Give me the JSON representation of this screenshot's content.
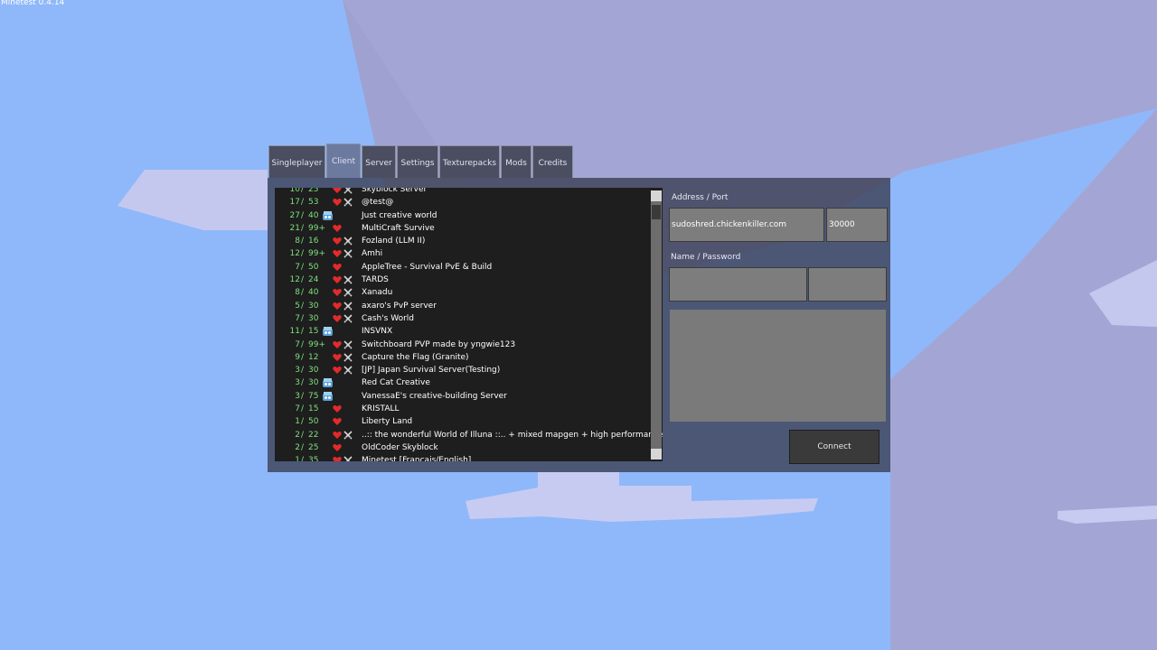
{
  "version": "Minetest 0.4.14",
  "tabs": [
    {
      "label": "Singleplayer",
      "active": false
    },
    {
      "label": "Client",
      "active": true
    },
    {
      "label": "Server",
      "active": false
    },
    {
      "label": "Settings",
      "active": false
    },
    {
      "label": "Texturepacks",
      "active": false
    },
    {
      "label": "Mods",
      "active": false
    },
    {
      "label": "Credits",
      "active": false
    }
  ],
  "server_list": [
    {
      "clients": "10",
      "max": "25",
      "flags": [
        "damage",
        "pvp"
      ],
      "name": "Skyblock Server"
    },
    {
      "clients": "17",
      "max": "53",
      "flags": [
        "damage",
        "pvp"
      ],
      "name": "@test@"
    },
    {
      "clients": "27",
      "max": "40",
      "flags": [
        "creative"
      ],
      "name": "Just creative world"
    },
    {
      "clients": "21",
      "max": "99+",
      "flags": [
        "damage"
      ],
      "name": "MultiCraft Survive"
    },
    {
      "clients": "8",
      "max": "16",
      "flags": [
        "damage",
        "pvp"
      ],
      "name": "Fozland (LLM II)"
    },
    {
      "clients": "12",
      "max": "99+",
      "flags": [
        "damage",
        "pvp"
      ],
      "name": "Amhi"
    },
    {
      "clients": "7",
      "max": "50",
      "flags": [
        "damage"
      ],
      "name": "AppleTree - Survival PvE & Build"
    },
    {
      "clients": "12",
      "max": "24",
      "flags": [
        "damage",
        "pvp"
      ],
      "name": "TARDS"
    },
    {
      "clients": "8",
      "max": "40",
      "flags": [
        "damage",
        "pvp"
      ],
      "name": "Xanadu"
    },
    {
      "clients": "5",
      "max": "30",
      "flags": [
        "damage",
        "pvp"
      ],
      "name": "axaro's PvP server"
    },
    {
      "clients": "7",
      "max": "30",
      "flags": [
        "damage",
        "pvp"
      ],
      "name": "Cash's World"
    },
    {
      "clients": "11",
      "max": "15",
      "flags": [
        "creative"
      ],
      "name": "INSVNX"
    },
    {
      "clients": "7",
      "max": "99+",
      "flags": [
        "damage",
        "pvp"
      ],
      "name": "Switchboard PVP made by yngwie123"
    },
    {
      "clients": "9",
      "max": "12",
      "flags": [
        "damage",
        "pvp"
      ],
      "name": "Capture the Flag (Granite)"
    },
    {
      "clients": "3",
      "max": "30",
      "flags": [
        "damage",
        "pvp"
      ],
      "name": "[JP] Japan Survival Server(Testing)"
    },
    {
      "clients": "3",
      "max": "30",
      "flags": [
        "creative"
      ],
      "name": "Red Cat Creative"
    },
    {
      "clients": "3",
      "max": "75",
      "flags": [
        "creative"
      ],
      "name": "VanessaE's creative-building Server"
    },
    {
      "clients": "7",
      "max": "15",
      "flags": [
        "damage"
      ],
      "name": "KRISTALL"
    },
    {
      "clients": "1",
      "max": "50",
      "flags": [
        "damage"
      ],
      "name": "Liberty Land"
    },
    {
      "clients": "2",
      "max": "22",
      "flags": [
        "damage",
        "pvp"
      ],
      "name": "..:: the wonderful World of Illuna ::.. + mixed mapgen + high performance +"
    },
    {
      "clients": "2",
      "max": "25",
      "flags": [
        "damage"
      ],
      "name": "OldCoder Skyblock"
    },
    {
      "clients": "1",
      "max": "35",
      "flags": [
        "damage",
        "pvp"
      ],
      "name": "Minetest [Français/English]"
    }
  ],
  "form": {
    "address_port_label": "Address / Port",
    "address_value": "sudoshred.chickenkiller.com",
    "port_value": "30000",
    "name_password_label": "Name / Password",
    "name_value": "",
    "password_value": "",
    "connect_label": "Connect"
  },
  "colors": {
    "sky": "#8fb8fa",
    "player_count": "#7ee07e",
    "panel": "#383c50",
    "list_background": "#1e1e1e"
  }
}
